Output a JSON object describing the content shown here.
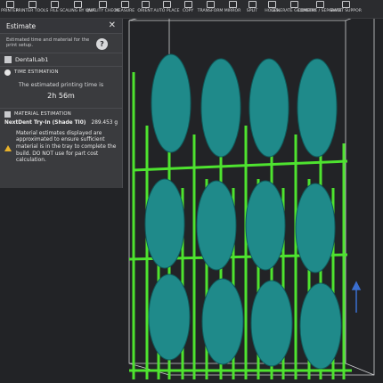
{
  "toolbar": {
    "items": [
      {
        "icon": "printer-icon",
        "label": "PRINTER"
      },
      {
        "icon": "printer-tools-icon",
        "label": "PRINTER TOOLS"
      },
      {
        "icon": "file-icon",
        "label": "FILE"
      },
      {
        "icon": "scaling-icon",
        "label": "SCALING BY UNIT"
      },
      {
        "icon": "quality-check-icon",
        "label": "QUALITY CHECK"
      },
      {
        "icon": "measure-icon",
        "label": "MEASURE"
      },
      {
        "icon": "orient-icon",
        "label": "ORIENT"
      },
      {
        "icon": "auto-place-icon",
        "label": "AUTO PLACE"
      },
      {
        "icon": "copy-icon",
        "label": "COPY"
      },
      {
        "icon": "transform-icon",
        "label": "TRANSFORM"
      },
      {
        "icon": "mirror-icon",
        "label": "MIRROR"
      },
      {
        "icon": "split-icon",
        "label": "SPLIT"
      },
      {
        "icon": "holes-icon",
        "label": "HOLES"
      },
      {
        "icon": "generate-geometry-icon",
        "label": "GENERATE GEOMETRY"
      },
      {
        "icon": "combine-separate-icon",
        "label": "COMBINE / SEPARATE"
      },
      {
        "icon": "smart-support-icon",
        "label": "SMART SUPPOR"
      }
    ]
  },
  "panel": {
    "title": "Estimate",
    "close": "✕",
    "description": "Estimated time and material for the print setup.",
    "help": "?",
    "printer": "DentalLab1",
    "time_caption": "TIME ESTIMATION",
    "time_text": "The estimated printing time is",
    "time_value": "2h  56m",
    "material_caption": "MATERIAL ESTIMATION",
    "material_name": "NextDent Try-In (Shade TI0)",
    "material_amount": "289.453 g",
    "warning": "Material estimates displayed are approximated to ensure sufficient material is in the tray to complete the build. DO NOT use for part cost calculation."
  },
  "colors": {
    "model": "#1f8a8a",
    "support": "#4ee32f",
    "box": "#cfd0d2",
    "panel": "#3a3b3e",
    "warning": "#e8b22b"
  }
}
